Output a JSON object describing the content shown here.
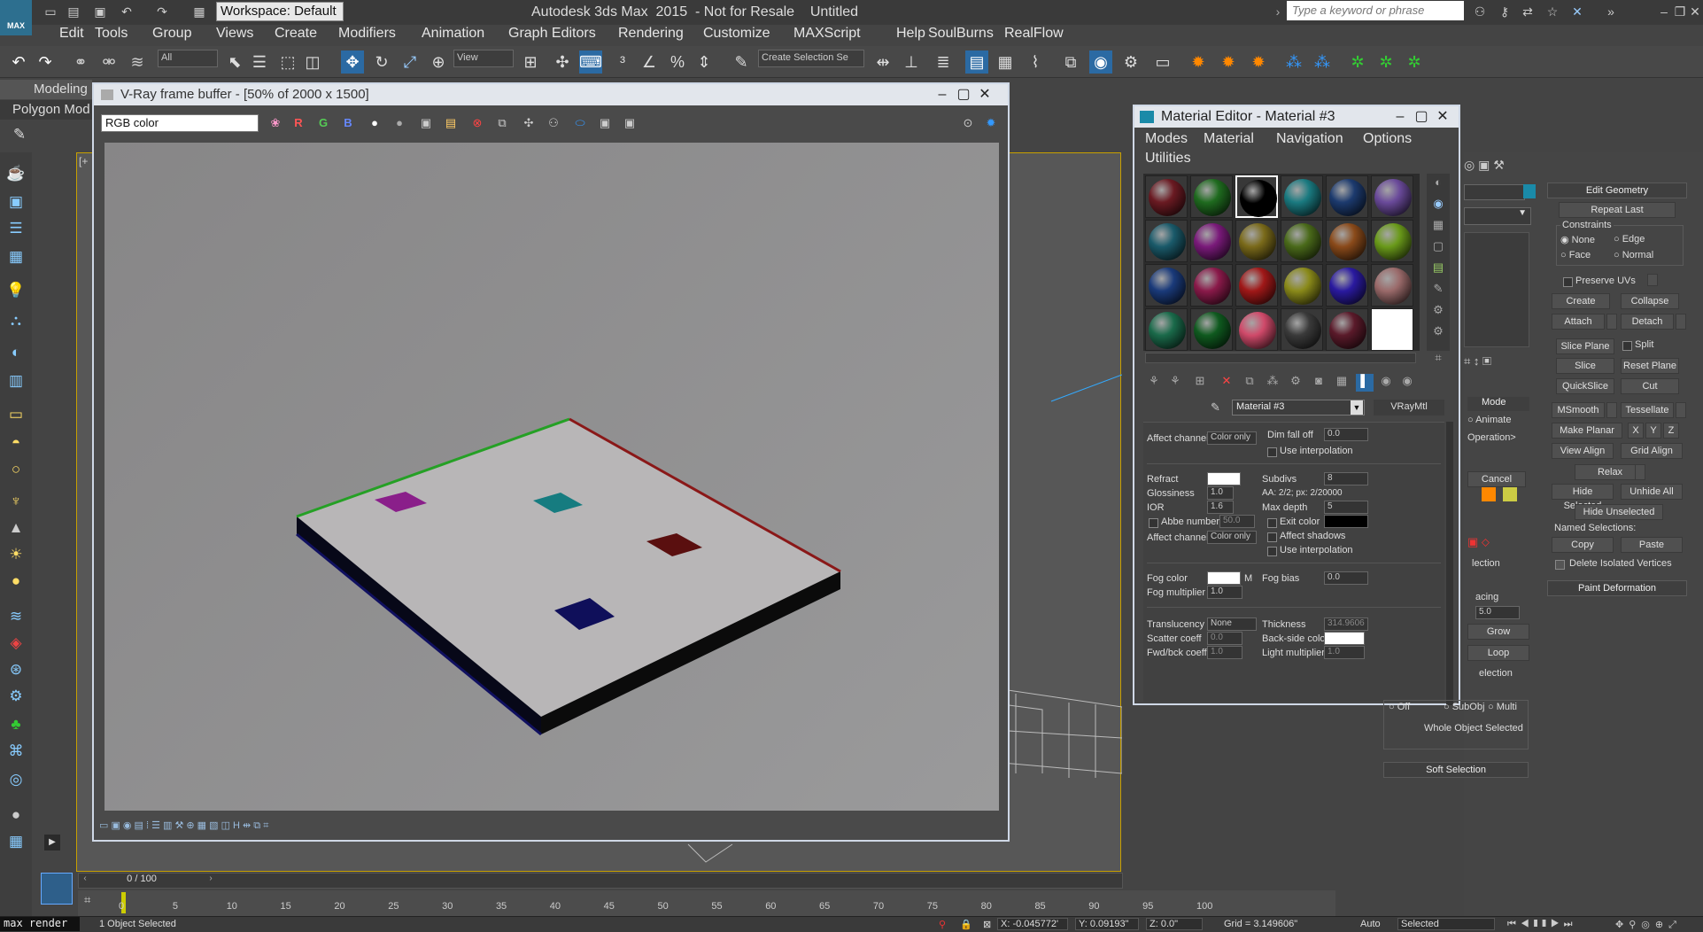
{
  "app": {
    "title": "Autodesk 3ds Max  2015  - Not for Resale    Untitled",
    "logo_text": "MAX",
    "workspace": "Workspace: Default",
    "search_placeholder": "Type a keyword or phrase"
  },
  "menu": [
    "Edit",
    "Tools",
    "Group",
    "Views",
    "Create",
    "Modifiers",
    "Animation",
    "Graph Editors",
    "Rendering",
    "Customize",
    "MAXScript",
    "Help",
    "SoulBurns",
    "RealFlow"
  ],
  "toolbar": {
    "filter": "All",
    "ref_coord": "View",
    "selection_set": "Create Selection Se"
  },
  "ribbon": {
    "tab_modeling": "Modeling",
    "tab_polygon": "Polygon Mod"
  },
  "vfb": {
    "title": "V-Ray frame buffer - [50% of 2000 x 1500]",
    "channel": "RGB color",
    "btn_r": "R",
    "btn_g": "G",
    "btn_b": "B"
  },
  "material_editor": {
    "title": "Material Editor - Material #3",
    "menus": [
      "Modes",
      "Material",
      "Navigation",
      "Options",
      "Utilities"
    ],
    "material_name": "Material #3",
    "material_type": "VRayMtl",
    "slot_colors": [
      [
        "#6a1a22",
        "#1f6b1f",
        "#000000",
        "#1a7a80",
        "#1c3a6e",
        "#6a4a9a"
      ],
      [
        "#1a5a6a",
        "#7a1a7a",
        "#7a6a1a",
        "#4a6a1a",
        "#8a4a1a",
        "#6a9a1a"
      ],
      [
        "#1a3a7a",
        "#8a1a4a",
        "#a01818",
        "#8a8a1a",
        "#2a1aa0",
        "#9a6a6a"
      ],
      [
        "#1a6a4a",
        "#0f5a1f",
        "#d04a6a",
        "#3a3a3a",
        "#5a1a2a",
        "#ffffff"
      ]
    ],
    "params": {
      "affect_channels_label": "Affect channels",
      "affect_channels_value": "Color only",
      "dim_falloff_label": "Dim fall off",
      "dim_falloff_value": "0.0",
      "use_interpolation_label": "Use interpolation",
      "refract_label": "Refract",
      "subdivs_label": "Subdivs",
      "subdivs_value": "8",
      "aa_info": "AA: 2/2; px: 2/20000",
      "glossiness_label": "Glossiness",
      "glossiness_value": "1.0",
      "ior_label": "IOR",
      "ior_value": "1.6",
      "max_depth_label": "Max depth",
      "max_depth_value": "5",
      "abbe_label": "Abbe number",
      "abbe_value": "50.0",
      "exit_color_label": "Exit color",
      "affect_shadows_label": "Affect shadows",
      "fog_color_label": "Fog color",
      "fog_m": "M",
      "fog_bias_label": "Fog bias",
      "fog_bias_value": "0.0",
      "fog_mult_label": "Fog multiplier",
      "fog_mult_value": "1.0",
      "translucency_label": "Translucency",
      "translucency_value": "None",
      "thickness_label": "Thickness",
      "thickness_value": "314.9606",
      "scatter_label": "Scatter coeff",
      "scatter_value": "0.0",
      "backside_label": "Back-side color",
      "fwdbck_label": "Fwd/bck coeff",
      "fwdbck_value": "1.0",
      "light_mult_label": "Light multiplier",
      "light_mult_value": "1.0"
    }
  },
  "command_panel": {
    "rollout_title": "Edit Geometry",
    "repeat_last": "Repeat Last",
    "constraints": "Constraints",
    "c_none": "None",
    "c_edge": "Edge",
    "c_face": "Face",
    "c_normal": "Normal",
    "preserve_uvs": "Preserve UVs",
    "create": "Create",
    "collapse": "Collapse",
    "attach": "Attach",
    "detach": "Detach",
    "slice_plane": "Slice Plane",
    "split": "Split",
    "slice": "Slice",
    "reset_plane": "Reset Plane",
    "quickslice": "QuickSlice",
    "cut": "Cut",
    "msmooth": "MSmooth",
    "tessellate": "Tessellate",
    "make_planar": "Make Planar",
    "x": "X",
    "y": "Y",
    "z": "Z",
    "view_align": "View Align",
    "grid_align": "Grid Align",
    "relax": "Relax",
    "hide_selected": "Hide Selected",
    "unhide_all": "Unhide All",
    "hide_unselected": "Hide Unselected",
    "named_selections": "Named Selections:",
    "copy": "Copy",
    "paste": "Paste",
    "delete_isolated": "Delete Isolated Vertices",
    "paint_deformation": "Paint Deformation",
    "mode": "Mode",
    "animate": "Animate",
    "operation": "Operation>",
    "cancel": "Cancel",
    "lection": "lection",
    "acing": "acing",
    "acing_val": "5.0",
    "grow": "Grow",
    "loop": "Loop",
    "selection": "election",
    "off": "Off",
    "subobj": "SubObj",
    "multi": "Multi",
    "whole_object": "Whole Object Selected",
    "soft_selection": "Soft Selection"
  },
  "timeline": {
    "time": "0 / 100",
    "ticks": [
      "0",
      "5",
      "10",
      "15",
      "20",
      "25",
      "30",
      "35",
      "40",
      "45",
      "50",
      "55",
      "60",
      "65",
      "70",
      "75",
      "80",
      "85",
      "90",
      "95",
      "100"
    ]
  },
  "status": {
    "maxscript": "max render",
    "selected": "1 Object Selected",
    "x": "X: -0.045772'",
    "y": "Y: 0.09193\"",
    "z": "Z: 0.0\"",
    "grid": "Grid = 3.149606\"",
    "auto": "Auto",
    "selected_mode": "Selected"
  }
}
